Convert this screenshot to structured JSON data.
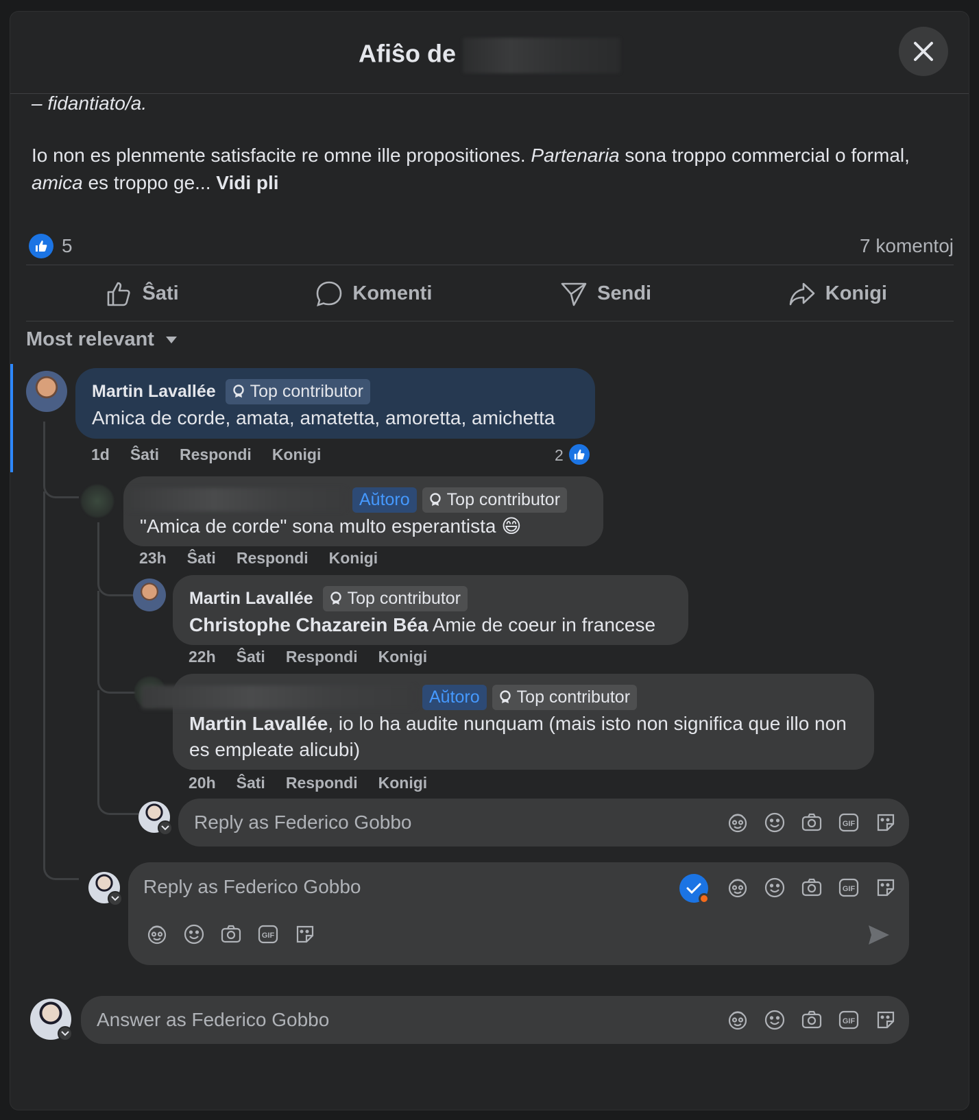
{
  "dialog": {
    "title": "Afiŝo de",
    "close_icon": "close-icon"
  },
  "post": {
    "line1": "– fidantiato/a.",
    "p_a": "Io non es plenmente satisfacite re omne ille propositiones. ",
    "p_b": "Partenaria",
    "p_c": " sona troppo commercial o formal, ",
    "p_d": "amica",
    "p_e": " es troppo ge... ",
    "see_more": "Vidi pli"
  },
  "stats": {
    "likes": "5",
    "comments": "7 komentoj"
  },
  "actions": {
    "like": "Ŝati",
    "comment": "Komenti",
    "send": "Sendi",
    "share": "Konigi"
  },
  "sort": {
    "label": "Most relevant"
  },
  "comments": [
    {
      "author": "Martin Lavallée",
      "badge": "Top contributor",
      "text": "Amica de corde, amata, amatetta, amoretta, amichetta",
      "time": "1d",
      "like": "Ŝati",
      "reply": "Respondi",
      "share": "Konigi",
      "reactions": "2"
    },
    {
      "author_badge": "Aŭtoro",
      "badge": "Top contributor",
      "text": "\"Amica de corde\" sona multo esperantista 😄",
      "time": "23h",
      "like": "Ŝati",
      "reply": "Respondi",
      "share": "Konigi"
    },
    {
      "author": "Martin Lavallée",
      "badge": "Top contributor",
      "mention": "Christophe Chazarein Béa",
      "text": " Amie de coeur in francese",
      "time": "22h",
      "like": "Ŝati",
      "reply": "Respondi",
      "share": "Konigi"
    },
    {
      "author_badge": "Aŭtoro",
      "badge": "Top contributor",
      "mention": "Martin Lavallée",
      "text": ", io lo ha audite nunquam (mais isto non significa que illo non es empleate alicubi)",
      "time": "20h",
      "like": "Ŝati",
      "reply": "Respondi",
      "share": "Konigi"
    }
  ],
  "reply_inner": {
    "placeholder": "Reply as Federico Gobbo"
  },
  "reply_outer": {
    "placeholder": "Reply as Federico Gobbo"
  },
  "answer": {
    "placeholder": "Answer as Federico Gobbo"
  },
  "colors": {
    "dialog_bg": "#242526",
    "bubble_bg": "#3a3b3c",
    "highlight_bg": "#263951",
    "accent": "#1b74e4",
    "author_badge_text": "#4599ff"
  }
}
